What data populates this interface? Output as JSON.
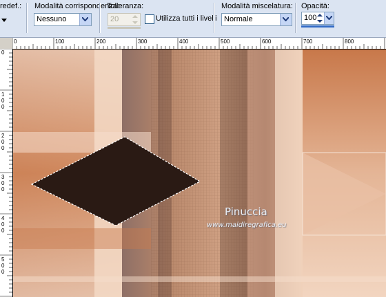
{
  "toolbar": {
    "predef_label": "redef.:",
    "match_mode": {
      "label": "Modalità corrispondenza:",
      "value": "Nessuno"
    },
    "tolerance": {
      "label": "Tolleranza:",
      "value": "20"
    },
    "use_all_layers": {
      "label": "Utilizza tutti i livelli",
      "checked": false
    },
    "blend_mode": {
      "label": "Modalità miscelatura:",
      "value": "Normale"
    },
    "opacity": {
      "label": "Opacità:",
      "value": "100"
    }
  },
  "ruler": {
    "horizontal_labels": [
      "0",
      "100",
      "200",
      "300",
      "400",
      "500",
      "600",
      "700",
      "800"
    ],
    "vertical_labels": [
      "0",
      "100",
      "200",
      "300",
      "400",
      "500"
    ]
  },
  "watermark": {
    "name": "Pinuccia",
    "url": "www.maidiregrafica.eu"
  },
  "colors": {
    "diamond_fill": "#2a1a14",
    "toolbar_bg": "#dbe4f2",
    "accent": "#316ac5"
  }
}
